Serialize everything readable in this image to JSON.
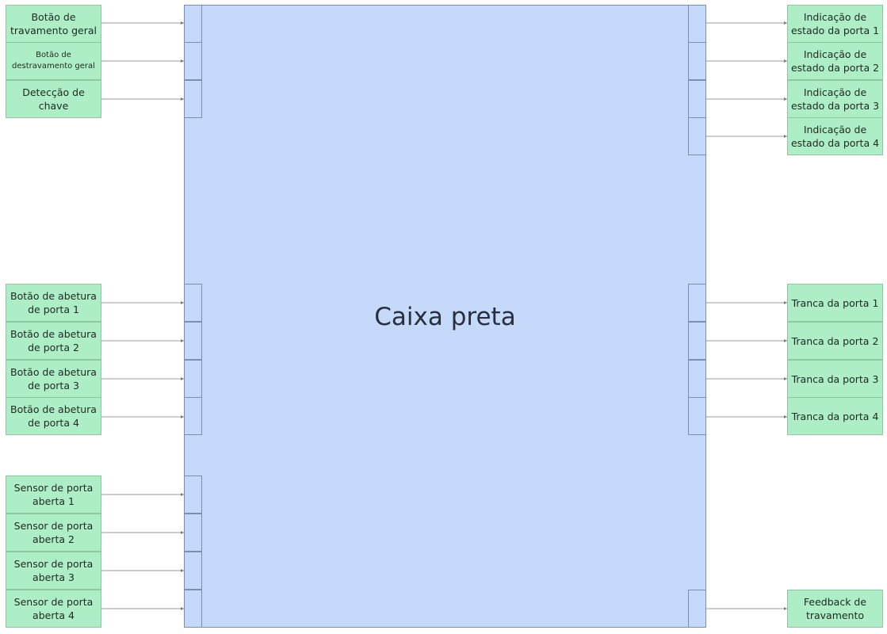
{
  "diagram": {
    "title": "Caixa preta",
    "left_blocks": [
      {
        "id": "lock-all",
        "label": "Botão de travamento geral"
      },
      {
        "id": "unlock-all",
        "label": "Botão de destravamento geral"
      },
      {
        "id": "key-detect",
        "label": "Detecção de chave"
      },
      {
        "id": "open-btn-1",
        "label": "Botão de abetura de porta 1"
      },
      {
        "id": "open-btn-2",
        "label": "Botão de abetura de porta 2"
      },
      {
        "id": "open-btn-3",
        "label": "Botão de abetura de porta 3"
      },
      {
        "id": "open-btn-4",
        "label": "Botão de abetura de porta 4"
      },
      {
        "id": "sensor-1",
        "label": "Sensor de porta aberta 1"
      },
      {
        "id": "sensor-2",
        "label": "Sensor de porta aberta 2"
      },
      {
        "id": "sensor-3",
        "label": "Sensor de porta aberta 3"
      },
      {
        "id": "sensor-4",
        "label": "Sensor de porta aberta 4"
      }
    ],
    "right_blocks": [
      {
        "id": "status-1",
        "label": "Indicação de estado da porta 1"
      },
      {
        "id": "status-2",
        "label": "Indicação de estado da porta 2"
      },
      {
        "id": "status-3",
        "label": "Indicação de estado da porta 3"
      },
      {
        "id": "status-4",
        "label": "Indicação de estado da porta 4"
      },
      {
        "id": "lock-1",
        "label": "Tranca da porta 1"
      },
      {
        "id": "lock-2",
        "label": "Tranca da porta 2"
      },
      {
        "id": "lock-3",
        "label": "Tranca da porta 3"
      },
      {
        "id": "lock-4",
        "label": "Tranca da porta 4"
      },
      {
        "id": "lock-feedback",
        "label": "Feedback de travamento"
      }
    ],
    "colors": {
      "main_fill": "#c5d9fb",
      "main_border": "#7b8fb6",
      "block_fill": "#aeeec6",
      "block_border": "#8fc7a1",
      "wire": "#9a9a9a"
    }
  }
}
